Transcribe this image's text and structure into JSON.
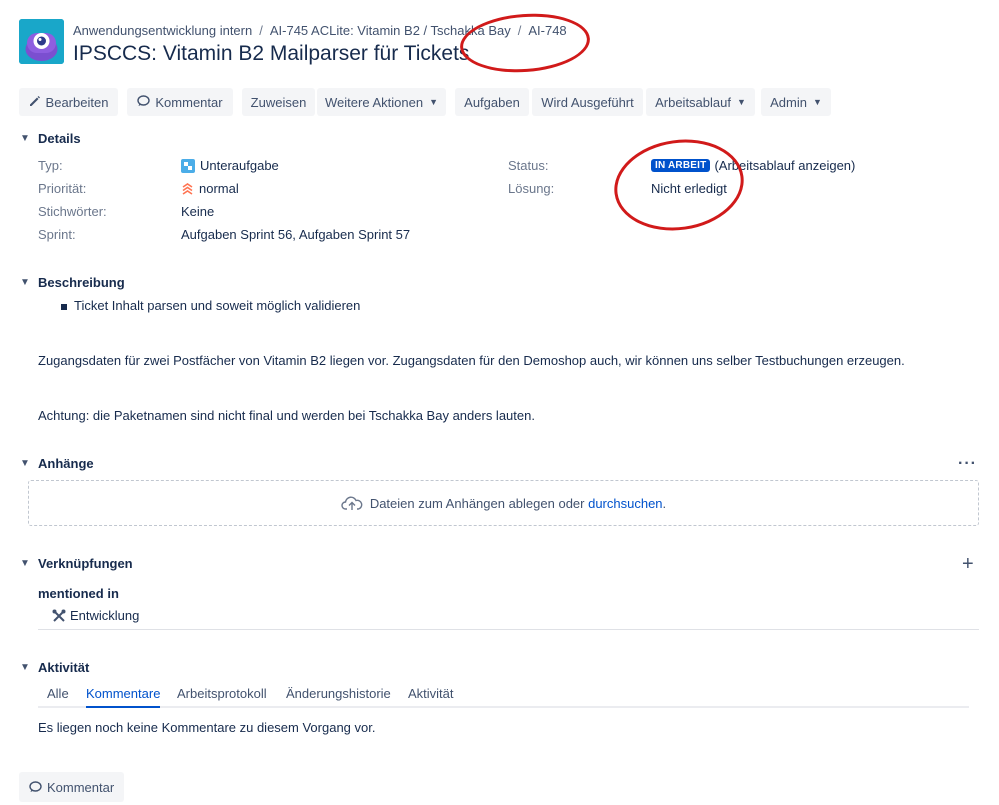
{
  "breadcrumbs": [
    "Anwendungsentwicklung intern",
    "AI-745 ACLite: Vitamin B2 / Tschakka Bay",
    "AI-748"
  ],
  "issue": {
    "title": "IPSCCS: Vitamin B2 Mailparser für Tickets"
  },
  "toolbar": {
    "edit": "Bearbeiten",
    "comment": "Kommentar",
    "assign": "Zuweisen",
    "more": "Weitere Aktionen",
    "tasks": "Aufgaben",
    "in_progress": "Wird Ausgeführt",
    "workflow": "Arbeitsablauf",
    "admin": "Admin"
  },
  "details": {
    "heading": "Details",
    "type_label": "Typ:",
    "type_value": "Unteraufgabe",
    "priority_label": "Priorität:",
    "priority_value": "normal",
    "labels_label": "Stichwörter:",
    "labels_value": "Keine",
    "sprint_label": "Sprint:",
    "sprint_value": "Aufgaben Sprint 56, Aufgaben Sprint 57",
    "status_label": "Status:",
    "status_value": "IN ARBEIT",
    "status_link": "(Arbeitsablauf anzeigen)",
    "resolution_label": "Lösung:",
    "resolution_value": "Nicht erledigt"
  },
  "description": {
    "heading": "Beschreibung",
    "bullet": "Ticket Inhalt parsen und soweit möglich validieren",
    "para1": "Zugangsdaten für zwei Postfächer von Vitamin B2 liegen vor. Zugangsdaten für den Demoshop auch, wir können uns selber Testbuchungen erzeugen.",
    "para2": "Achtung: die Paketnamen sind nicht final und werden bei Tschakka Bay anders lauten."
  },
  "attachments": {
    "heading": "Anhänge",
    "drop_text": "Dateien zum Anhängen ablegen oder ",
    "browse_link": "durchsuchen",
    "drop_suffix": "."
  },
  "links": {
    "heading": "Verknüpfungen",
    "relation": "mentioned in",
    "item": "Entwicklung"
  },
  "activity": {
    "heading": "Aktivität",
    "tabs": [
      "Alle",
      "Kommentare",
      "Arbeitsprotokoll",
      "Änderungshistorie",
      "Aktivität"
    ],
    "empty": "Es liegen noch keine Kommentare zu diesem Vorgang vor.",
    "comment_button": "Kommentar"
  },
  "colors": {
    "accent": "#0052cc",
    "annotation": "#d11a1a",
    "button_bg": "#f4f5f7"
  },
  "icons": [
    "project-avatar-icon",
    "pencil-icon",
    "comment-bubble-icon",
    "chevron-down-icon",
    "subtask-icon",
    "priority-normal-icon",
    "cloud-upload-icon",
    "more-icon",
    "plus-icon",
    "development-link-icon"
  ]
}
